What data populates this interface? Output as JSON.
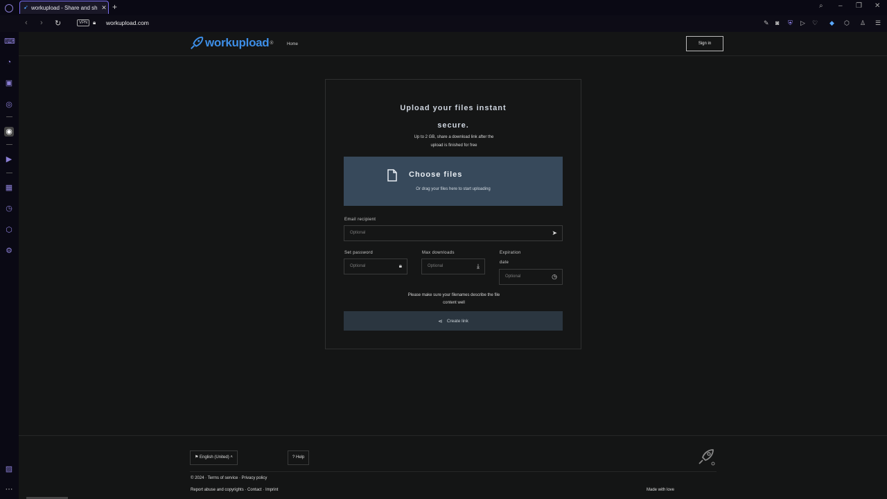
{
  "tab": {
    "title": "workupload - Share and sh",
    "new_tab": "+"
  },
  "window": {
    "minimize": "–",
    "restore": "❐",
    "close": "✕",
    "search": "⌕"
  },
  "addressbar": {
    "vpn": "VPN",
    "url": "workupload.com"
  },
  "site": {
    "logo_text": "workupload",
    "logo_mark": "®",
    "nav_link": "Home",
    "login": "Sign in"
  },
  "card": {
    "title_line1": "Upload your files instant",
    "title_line2": "secure.",
    "subtitle_line1": "Up to 2 GB, share a download link after the",
    "subtitle_line2": "upload is finished for free",
    "dropzone_main": "Choose files",
    "dropzone_hint": "Or drag your files here to start uploading",
    "email_label": "Email recipient",
    "email_placeholder": "Optional",
    "password_label": "Set password",
    "password_placeholder": "Optional",
    "max_downloads_label": "Max downloads",
    "max_downloads_placeholder": "Optional",
    "expiration_label": "Expiration",
    "expiration_label2": "date",
    "expiration_placeholder": "Optional",
    "note_line1": "Please make sure your filenames describe the file",
    "note_line2": "content well",
    "share_button": "Create link"
  },
  "footer": {
    "language": "English (United)",
    "help": "? Help",
    "links_line": "© 2024 · Terms of service · Privacy policy",
    "links_line2": "Report abuse and copyrights · Contact · Imprint",
    "right_text": "Made with love"
  }
}
